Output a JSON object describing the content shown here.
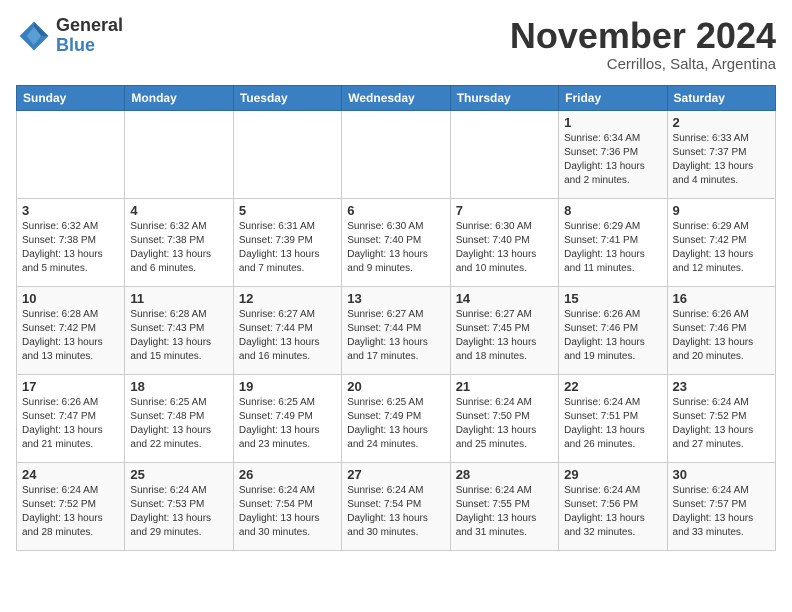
{
  "header": {
    "logo_general": "General",
    "logo_blue": "Blue",
    "month_title": "November 2024",
    "subtitle": "Cerrillos, Salta, Argentina"
  },
  "days_of_week": [
    "Sunday",
    "Monday",
    "Tuesday",
    "Wednesday",
    "Thursday",
    "Friday",
    "Saturday"
  ],
  "weeks": [
    [
      {
        "day": "",
        "info": ""
      },
      {
        "day": "",
        "info": ""
      },
      {
        "day": "",
        "info": ""
      },
      {
        "day": "",
        "info": ""
      },
      {
        "day": "",
        "info": ""
      },
      {
        "day": "1",
        "info": "Sunrise: 6:34 AM\nSunset: 7:36 PM\nDaylight: 13 hours and 2 minutes."
      },
      {
        "day": "2",
        "info": "Sunrise: 6:33 AM\nSunset: 7:37 PM\nDaylight: 13 hours and 4 minutes."
      }
    ],
    [
      {
        "day": "3",
        "info": "Sunrise: 6:32 AM\nSunset: 7:38 PM\nDaylight: 13 hours and 5 minutes."
      },
      {
        "day": "4",
        "info": "Sunrise: 6:32 AM\nSunset: 7:38 PM\nDaylight: 13 hours and 6 minutes."
      },
      {
        "day": "5",
        "info": "Sunrise: 6:31 AM\nSunset: 7:39 PM\nDaylight: 13 hours and 7 minutes."
      },
      {
        "day": "6",
        "info": "Sunrise: 6:30 AM\nSunset: 7:40 PM\nDaylight: 13 hours and 9 minutes."
      },
      {
        "day": "7",
        "info": "Sunrise: 6:30 AM\nSunset: 7:40 PM\nDaylight: 13 hours and 10 minutes."
      },
      {
        "day": "8",
        "info": "Sunrise: 6:29 AM\nSunset: 7:41 PM\nDaylight: 13 hours and 11 minutes."
      },
      {
        "day": "9",
        "info": "Sunrise: 6:29 AM\nSunset: 7:42 PM\nDaylight: 13 hours and 12 minutes."
      }
    ],
    [
      {
        "day": "10",
        "info": "Sunrise: 6:28 AM\nSunset: 7:42 PM\nDaylight: 13 hours and 13 minutes."
      },
      {
        "day": "11",
        "info": "Sunrise: 6:28 AM\nSunset: 7:43 PM\nDaylight: 13 hours and 15 minutes."
      },
      {
        "day": "12",
        "info": "Sunrise: 6:27 AM\nSunset: 7:44 PM\nDaylight: 13 hours and 16 minutes."
      },
      {
        "day": "13",
        "info": "Sunrise: 6:27 AM\nSunset: 7:44 PM\nDaylight: 13 hours and 17 minutes."
      },
      {
        "day": "14",
        "info": "Sunrise: 6:27 AM\nSunset: 7:45 PM\nDaylight: 13 hours and 18 minutes."
      },
      {
        "day": "15",
        "info": "Sunrise: 6:26 AM\nSunset: 7:46 PM\nDaylight: 13 hours and 19 minutes."
      },
      {
        "day": "16",
        "info": "Sunrise: 6:26 AM\nSunset: 7:46 PM\nDaylight: 13 hours and 20 minutes."
      }
    ],
    [
      {
        "day": "17",
        "info": "Sunrise: 6:26 AM\nSunset: 7:47 PM\nDaylight: 13 hours and 21 minutes."
      },
      {
        "day": "18",
        "info": "Sunrise: 6:25 AM\nSunset: 7:48 PM\nDaylight: 13 hours and 22 minutes."
      },
      {
        "day": "19",
        "info": "Sunrise: 6:25 AM\nSunset: 7:49 PM\nDaylight: 13 hours and 23 minutes."
      },
      {
        "day": "20",
        "info": "Sunrise: 6:25 AM\nSunset: 7:49 PM\nDaylight: 13 hours and 24 minutes."
      },
      {
        "day": "21",
        "info": "Sunrise: 6:24 AM\nSunset: 7:50 PM\nDaylight: 13 hours and 25 minutes."
      },
      {
        "day": "22",
        "info": "Sunrise: 6:24 AM\nSunset: 7:51 PM\nDaylight: 13 hours and 26 minutes."
      },
      {
        "day": "23",
        "info": "Sunrise: 6:24 AM\nSunset: 7:52 PM\nDaylight: 13 hours and 27 minutes."
      }
    ],
    [
      {
        "day": "24",
        "info": "Sunrise: 6:24 AM\nSunset: 7:52 PM\nDaylight: 13 hours and 28 minutes."
      },
      {
        "day": "25",
        "info": "Sunrise: 6:24 AM\nSunset: 7:53 PM\nDaylight: 13 hours and 29 minutes."
      },
      {
        "day": "26",
        "info": "Sunrise: 6:24 AM\nSunset: 7:54 PM\nDaylight: 13 hours and 30 minutes."
      },
      {
        "day": "27",
        "info": "Sunrise: 6:24 AM\nSunset: 7:54 PM\nDaylight: 13 hours and 30 minutes."
      },
      {
        "day": "28",
        "info": "Sunrise: 6:24 AM\nSunset: 7:55 PM\nDaylight: 13 hours and 31 minutes."
      },
      {
        "day": "29",
        "info": "Sunrise: 6:24 AM\nSunset: 7:56 PM\nDaylight: 13 hours and 32 minutes."
      },
      {
        "day": "30",
        "info": "Sunrise: 6:24 AM\nSunset: 7:57 PM\nDaylight: 13 hours and 33 minutes."
      }
    ]
  ]
}
